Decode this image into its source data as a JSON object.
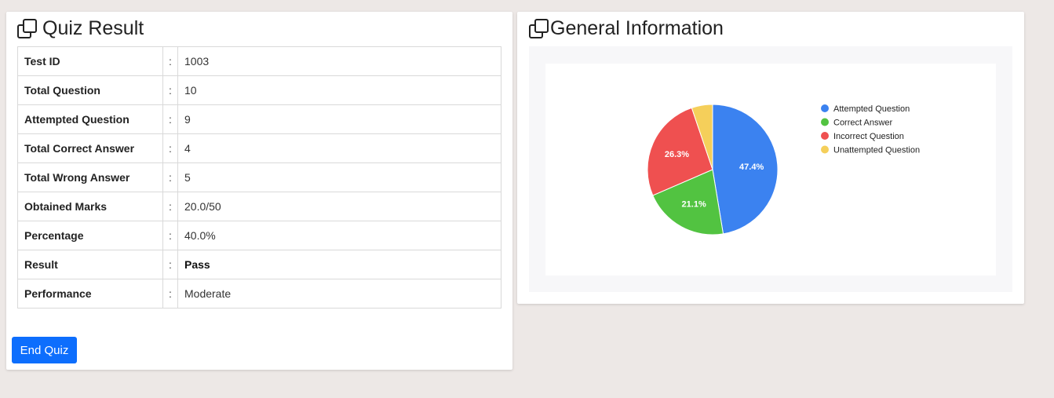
{
  "quiz": {
    "title": "Quiz Result",
    "rows": [
      {
        "label": "Test ID",
        "sep": ":",
        "value": "1003"
      },
      {
        "label": "Total Question",
        "sep": ":",
        "value": "10"
      },
      {
        "label": "Attempted Question",
        "sep": ":",
        "value": "9"
      },
      {
        "label": "Total Correct Answer",
        "sep": ":",
        "value": "4"
      },
      {
        "label": "Total Wrong Answer",
        "sep": ":",
        "value": "5"
      },
      {
        "label": "Obtained Marks",
        "sep": ":",
        "value": "20.0/50"
      },
      {
        "label": "Percentage",
        "sep": ":",
        "value": "40.0%"
      },
      {
        "label": "Result",
        "sep": ":",
        "value": "Pass"
      },
      {
        "label": "Performance",
        "sep": ":",
        "value": "Moderate"
      }
    ],
    "end_button": "End Quiz"
  },
  "info": {
    "title": "General Information"
  },
  "icons": {
    "title_icon": "copy-icon"
  },
  "colors": {
    "primary": "#0d6efd",
    "page_bg": "#ede8e6"
  },
  "chart_data": {
    "type": "pie",
    "title": "",
    "labels": [
      "Attempted Question",
      "Correct Answer",
      "Incorrect Question",
      "Unattempted Question"
    ],
    "values": [
      47.4,
      21.1,
      26.3,
      5.2
    ],
    "value_labels": [
      "47.4%",
      "21.1%",
      "26.3%",
      ""
    ],
    "colors": [
      "#3b82f0",
      "#52c341",
      "#ef5050",
      "#f5cf5a"
    ],
    "legend_position": "right"
  }
}
